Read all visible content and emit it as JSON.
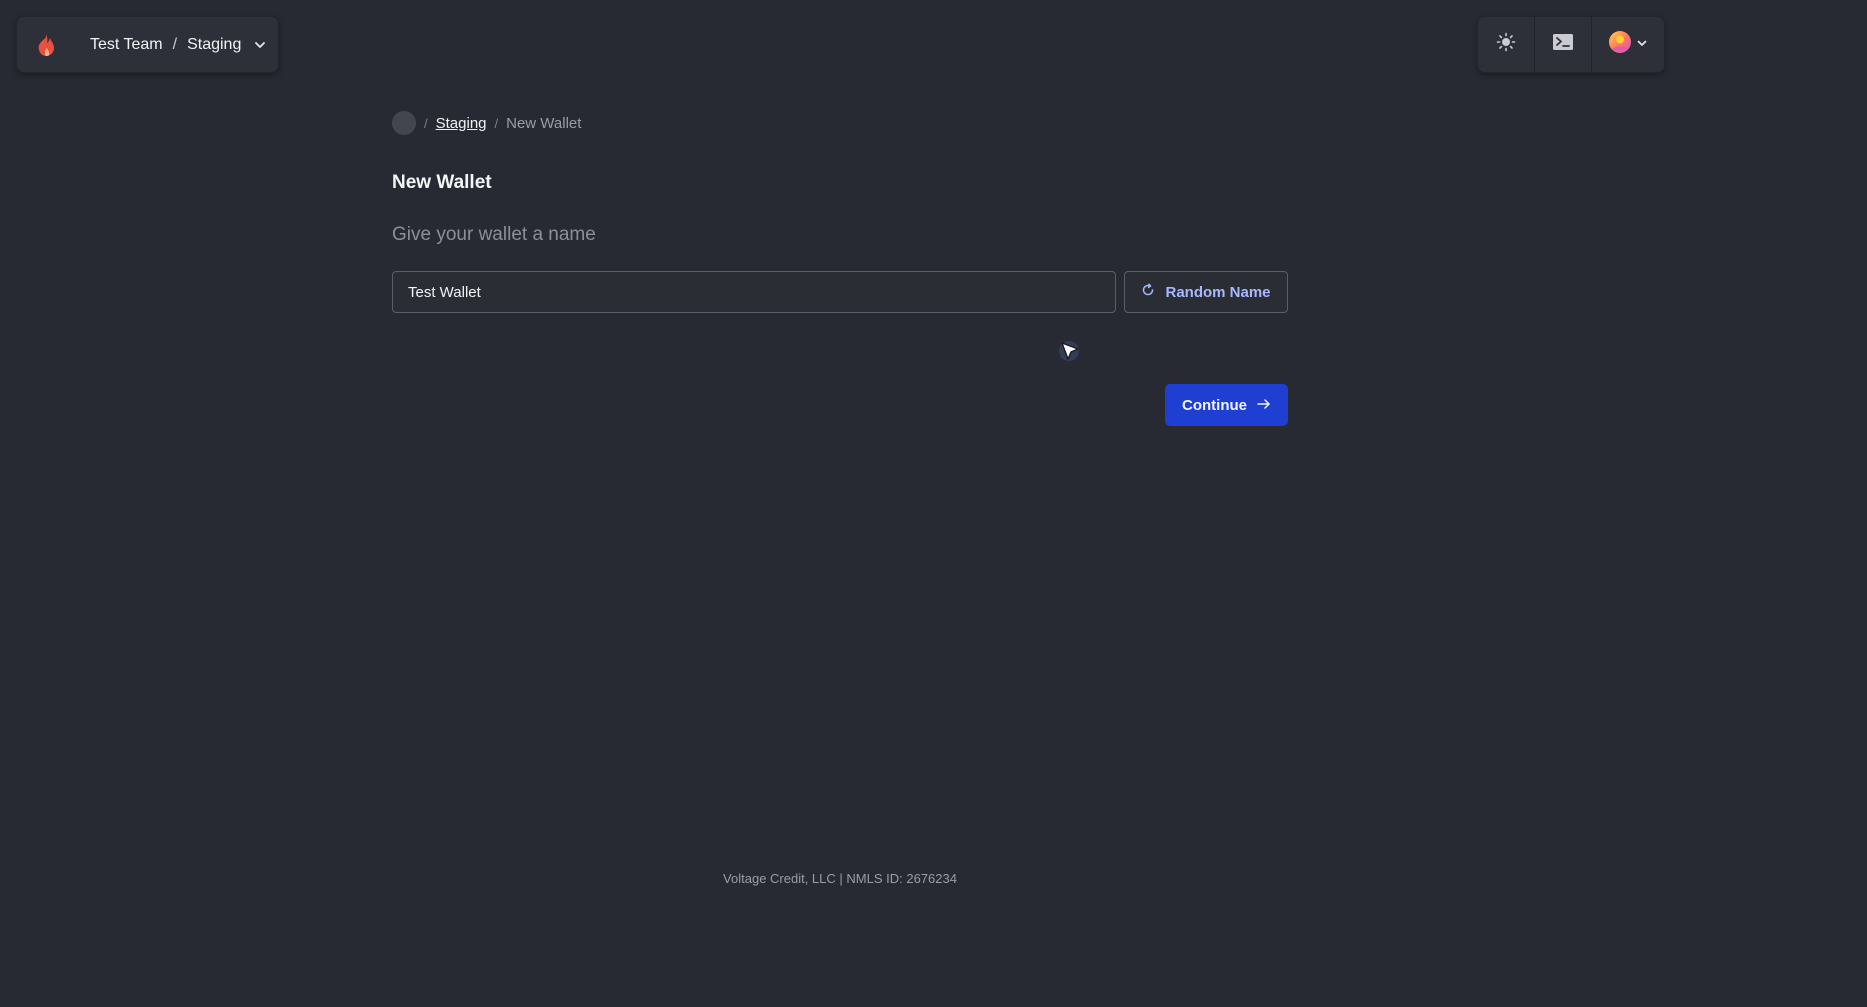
{
  "header": {
    "team_name": "Test Team",
    "separator": "/",
    "environment": "Staging",
    "logo_icon": "flame-logo-icon",
    "theme_icon": "sun-icon",
    "terminal_icon": "terminal-icon",
    "profile_icon": "avatar-icon"
  },
  "breadcrumb": {
    "separator": "/",
    "parent": "Staging",
    "current": "New Wallet"
  },
  "page": {
    "title": "New Wallet",
    "subtitle": "Give your wallet a name"
  },
  "form": {
    "wallet_name_value": "Test Wallet",
    "random_name_label": "Random Name",
    "continue_label": "Continue"
  },
  "footer": {
    "text": "Voltage Credit, LLC | NMLS ID: 2676234"
  },
  "colors": {
    "background": "#282a33",
    "accent": "#1e3fd1",
    "brand": "#e8513f"
  }
}
